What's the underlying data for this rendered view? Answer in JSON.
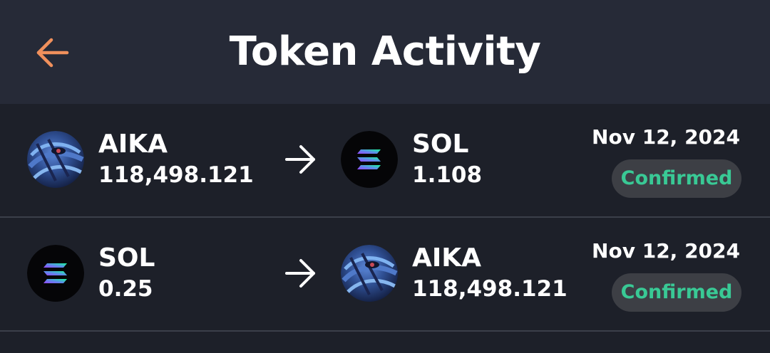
{
  "header": {
    "title": "Token Activity",
    "back_icon": "arrow-left-icon",
    "back_color": "#f0905c"
  },
  "activity": [
    {
      "from": {
        "symbol": "AIKA",
        "amount": "118,498.121",
        "icon": "aika-token-icon"
      },
      "to": {
        "symbol": "SOL",
        "amount": "1.108",
        "icon": "solana-token-icon"
      },
      "date": "Nov 12, 2024",
      "status": "Confirmed"
    },
    {
      "from": {
        "symbol": "SOL",
        "amount": "0.25",
        "icon": "solana-token-icon"
      },
      "to": {
        "symbol": "AIKA",
        "amount": "118,498.121",
        "icon": "aika-token-icon"
      },
      "date": "Nov 12, 2024",
      "status": "Confirmed"
    }
  ],
  "colors": {
    "background": "#1d2029",
    "header": "#262a37",
    "status_confirmed": "#39c995",
    "badge_bg": "#3d3f45",
    "divider": "#3b3f4a"
  }
}
